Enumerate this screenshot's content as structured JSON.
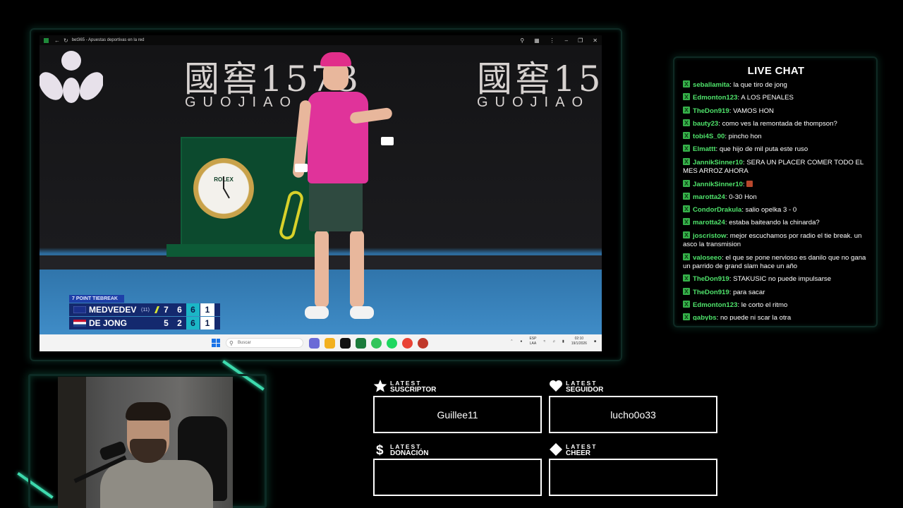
{
  "browser": {
    "tab_title": "bet365 - Apuestas deportivas en la red"
  },
  "video": {
    "banner_chinese": "國窖1573",
    "banner_latin": "GUOJIAO 1573",
    "banner_chinese_2": "國窖15",
    "banner_latin_2": "GUOJIAO",
    "clock_brand": "ROLEX",
    "scorebug": {
      "label": "7 POINT TIEBREAK",
      "players": [
        {
          "name": "MEDVEDEV",
          "seed": "(11)",
          "sets": [
            "7",
            "6"
          ],
          "current": "6",
          "points": "1"
        },
        {
          "name": "DE JONG",
          "seed": "",
          "sets": [
            "5",
            "2"
          ],
          "current": "6",
          "points": "1"
        }
      ]
    }
  },
  "taskbar": {
    "search_placeholder": "Buscar",
    "lang_top": "ESP",
    "lang_bottom": "LAA",
    "time": "02:10",
    "date": "19/1/2026"
  },
  "chat": {
    "title": "LIVE CHAT",
    "messages": [
      {
        "user": "seballamita",
        "text": "la que tiro de jong"
      },
      {
        "user": "Edmonton123",
        "text": "A LOS PENALES"
      },
      {
        "user": "TheDon919",
        "text": "VAMOS HON"
      },
      {
        "user": "bauty23",
        "text": "como ves la remontada de thompson?"
      },
      {
        "user": "tobi4S_00",
        "text": "pincho hon"
      },
      {
        "user": "Elmattt",
        "text": "que hijo de mil puta este ruso"
      },
      {
        "user": "JannikSinner10",
        "text": "SERA UN PLACER COMER TODO EL MES ARROZ AHORA"
      },
      {
        "user": "JannikSinner10",
        "text": "",
        "emote": true
      },
      {
        "user": "marotta24",
        "text": "0-30 Hon"
      },
      {
        "user": "CondorDrakula",
        "text": "salio opelka 3 - 0"
      },
      {
        "user": "marotta24",
        "text": "estaba baiteando la chinarda?"
      },
      {
        "user": "joscristow",
        "text": "mejor escuchamos por radio el tie break. un asco la transmision"
      },
      {
        "user": "valoseeo",
        "text": "el que se pone nervioso es danilo que no gana un parrido de grand slam hace un año"
      },
      {
        "user": "TheDon919",
        "text": "STAKUSIC no puede impulsarse"
      },
      {
        "user": "TheDon919",
        "text": "para sacar"
      },
      {
        "user": "Edmonton123",
        "text": "le corto el ritmo"
      },
      {
        "user": "gabybs",
        "text": "no puede ni scar la otra"
      }
    ]
  },
  "stats": {
    "subscriber": {
      "small": "LATEST",
      "big": "SUSCRIPTOR",
      "value": "Guillee11",
      "icon": "star-icon"
    },
    "follower": {
      "small": "LATEST",
      "big": "SEGUIDOR",
      "value": "lucho0o33",
      "icon": "heart-icon"
    },
    "donation": {
      "small": "LATEST",
      "big": "DONACIÓN",
      "value": "",
      "icon": "dollar-icon"
    },
    "cheer": {
      "small": "LATEST",
      "big": "CHEER",
      "value": "",
      "icon": "diamond-icon"
    }
  },
  "colors": {
    "accent": "#3fdcb0",
    "chat_user": "#4fe36b",
    "frame_glow": "#1e8c6e"
  }
}
